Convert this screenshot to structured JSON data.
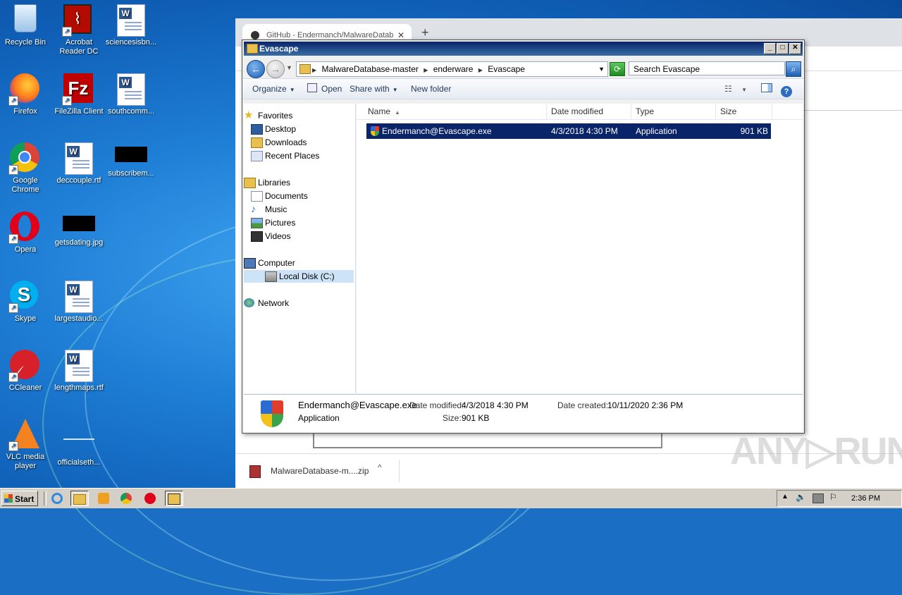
{
  "desktop": {
    "icons": [
      {
        "label": "Recycle Bin"
      },
      {
        "label": "Acrobat Reader DC"
      },
      {
        "label": "sciencesisbn..."
      },
      {
        "label": "Firefox"
      },
      {
        "label": "FileZilla Client"
      },
      {
        "label": "southcomm..."
      },
      {
        "label": "Google Chrome"
      },
      {
        "label": "deccouple.rtf"
      },
      {
        "label": "subscribem..."
      },
      {
        "label": "Opera"
      },
      {
        "label": "getsdating.jpg"
      },
      {
        "label": "Skype"
      },
      {
        "label": "largestaudio..."
      },
      {
        "label": "CCleaner"
      },
      {
        "label": "lengthmaps.rtf"
      },
      {
        "label": "VLC media player"
      },
      {
        "label": "officialseth..."
      }
    ]
  },
  "chrome": {
    "tab_title": "GitHub - Endermanch/MalwareDatab",
    "tab_close": "✕",
    "new_tab": "+",
    "download_file": "MalwareDatabase-m....zip",
    "download_chevron": "^"
  },
  "explorer": {
    "title": "Evascape",
    "window_buttons": {
      "minimize": "_",
      "maximize": "□",
      "close": "✕"
    },
    "breadcrumbs": [
      "MalwareDatabase-master",
      "enderware",
      "Evascape"
    ],
    "search_placeholder": "Search Evascape",
    "commands": {
      "organize": "Organize",
      "open": "Open",
      "share_with": "Share with",
      "new_folder": "New folder"
    },
    "nav": {
      "favorites": "Favorites",
      "desktop": "Desktop",
      "downloads": "Downloads",
      "recent_places": "Recent Places",
      "libraries": "Libraries",
      "documents": "Documents",
      "music": "Music",
      "pictures": "Pictures",
      "videos": "Videos",
      "computer": "Computer",
      "local_disk": "Local Disk (C:)",
      "network": "Network"
    },
    "columns": {
      "name": "Name",
      "date_modified": "Date modified",
      "type": "Type",
      "size": "Size"
    },
    "files": [
      {
        "name": "Endermanch@Evascape.exe",
        "date_modified": "4/3/2018 4:30 PM",
        "type": "Application",
        "size": "901 KB"
      }
    ],
    "details": {
      "name": "Endermanch@Evascape.exe",
      "type": "Application",
      "date_modified_label": "Date modified:",
      "date_modified": "4/3/2018 4:30 PM",
      "size_label": "Size:",
      "size": "901 KB",
      "date_created_label": "Date created:",
      "date_created": "10/11/2020 2:36 PM"
    }
  },
  "watermark": "ANY▷RUN",
  "taskbar": {
    "start_label": "Start",
    "clock": "2:36 PM"
  },
  "colors": {
    "selection": "#0a246a",
    "title_gradient_start": "#0a246a",
    "title_gradient_end": "#3a6ea5",
    "desktop_blue": "#1f7fd6"
  }
}
